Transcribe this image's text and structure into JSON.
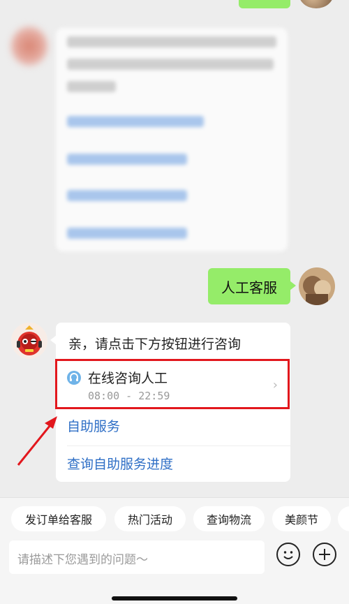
{
  "user_message": {
    "text": "人工客服"
  },
  "bot_message": {
    "text": "亲，请点击下方按钮进行咨询",
    "online_service": {
      "title": "在线咨询人工",
      "hours": "08:00 - 22:59"
    },
    "links": [
      "自助服务",
      "查询自助服务进度"
    ]
  },
  "quick_actions": [
    "发订单给客服",
    "热门活动",
    "查询物流",
    "美颜节"
  ],
  "input": {
    "placeholder": "请描述下您遇到的问题～"
  },
  "colors": {
    "user_bubble": "#95ec69",
    "link": "#2f6fc6",
    "highlight": "#e2171d",
    "background": "#ededed"
  }
}
